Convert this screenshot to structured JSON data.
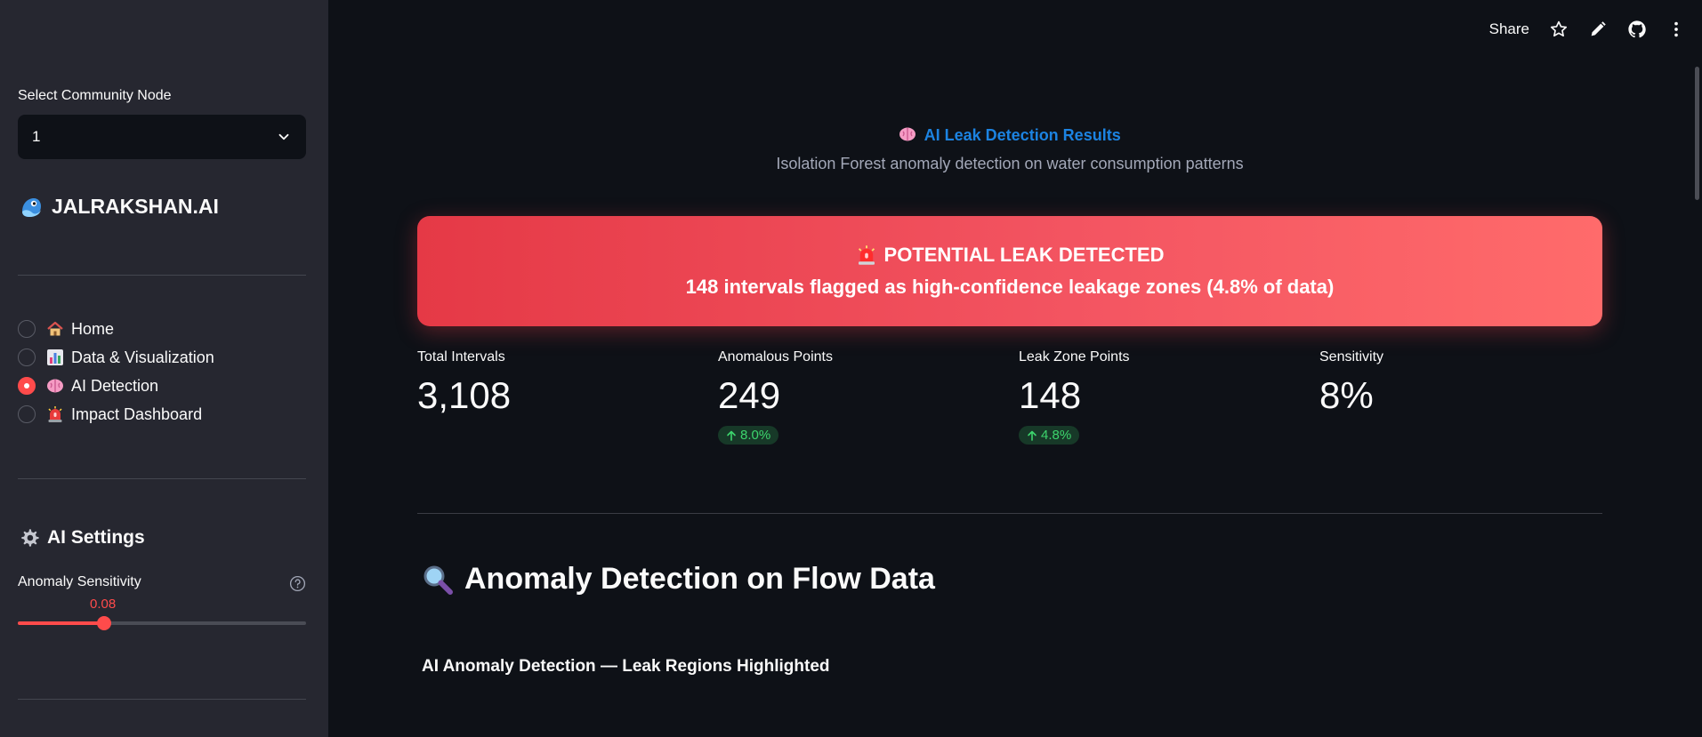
{
  "toolbar": {
    "share_label": "Share",
    "icons": [
      "star-icon",
      "pencil-icon",
      "github-icon",
      "more-vertical-icon"
    ]
  },
  "sidebar": {
    "node_select": {
      "label": "Select Community Node",
      "value": "1"
    },
    "brand": {
      "icon": "droplet-mascot-icon",
      "title": "JALRAKSHAN.AI"
    },
    "nav": [
      {
        "label": "Home",
        "icon": "house-icon",
        "selected": false
      },
      {
        "label": "Data & Visualization",
        "icon": "bar-chart-icon",
        "selected": false
      },
      {
        "label": "AI Detection",
        "icon": "brain-icon",
        "selected": true
      },
      {
        "label": "Impact Dashboard",
        "icon": "siren-icon",
        "selected": false
      }
    ],
    "settings": {
      "heading": "AI Settings",
      "icon": "gear-icon",
      "slider": {
        "label": "Anomaly Sensitivity",
        "value": "0.08",
        "fraction": 0.3
      }
    }
  },
  "main": {
    "title": "AI Leak Detection Results",
    "title_icon": "brain-icon",
    "subtitle": "Isolation Forest anomaly detection on water consumption patterns",
    "alert": {
      "icon": "siren-icon",
      "headline": "POTENTIAL LEAK DETECTED",
      "detail": "148 intervals flagged as high-confidence leakage zones (4.8% of data)"
    },
    "metrics": [
      {
        "label": "Total Intervals",
        "value": "3,108",
        "delta": null
      },
      {
        "label": "Anomalous Points",
        "value": "249",
        "delta": "8.0%"
      },
      {
        "label": "Leak Zone Points",
        "value": "148",
        "delta": "4.8%"
      },
      {
        "label": "Sensitivity",
        "value": "8%",
        "delta": null
      }
    ],
    "section": {
      "icon": "magnifier-icon",
      "heading": "Anomaly Detection on Flow Data"
    },
    "chart_title": "AI Anomaly Detection — Leak Regions Highlighted"
  },
  "colors": {
    "background": "#0e1117",
    "sidebar": "#262730",
    "accent": "#ff4b4b",
    "link": "#1c83e1",
    "delta_positive": "#3dd56d"
  }
}
